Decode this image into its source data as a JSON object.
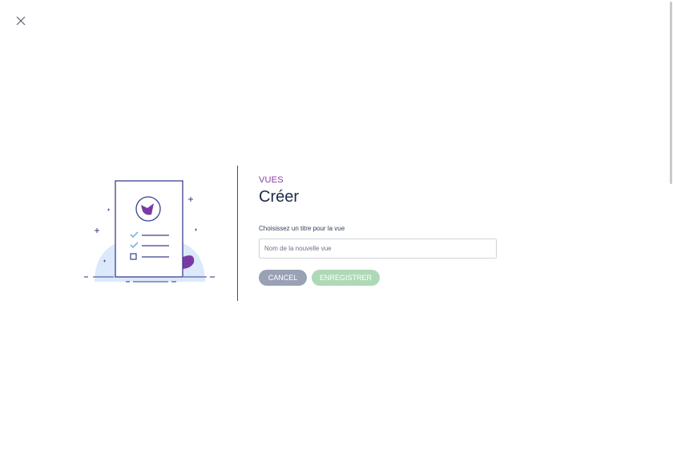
{
  "close": {
    "icon": "close-icon"
  },
  "header": {
    "eyebrow": "VUES",
    "title": "Créer"
  },
  "form": {
    "label": "Choisissez un titre pour la vue",
    "input_value": "",
    "input_placeholder": "Nom de la nouvelle vue"
  },
  "buttons": {
    "cancel_label": "CANCEL",
    "save_label": "ENREGISTRER"
  },
  "illustration": {
    "icon": "checklist-document-illustration"
  },
  "colors": {
    "accent": "#8e3aa8",
    "divider": "#6b2f8f",
    "title": "#1b2a4a",
    "cancel_button": "#9aa1b4",
    "save_button": "#aed9b6",
    "illustration_stroke": "#3b3f8f",
    "illustration_fill": "#dbe9fb"
  }
}
